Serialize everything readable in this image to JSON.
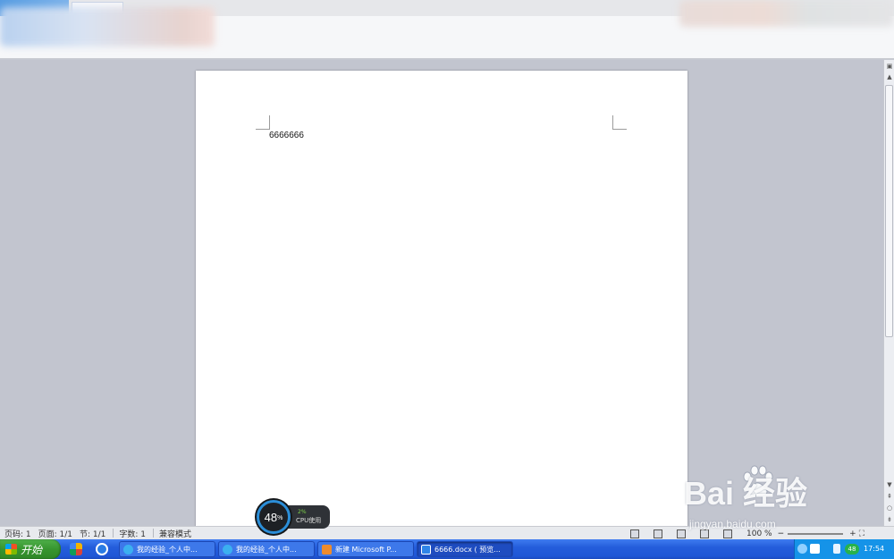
{
  "document": {
    "body_text": "6666666"
  },
  "status_bar": {
    "page_number": "页码: 1",
    "page_count": "页面: 1/1",
    "section": "节: 1/1",
    "word_count": "字数: 1",
    "mode": "兼容模式",
    "zoom": "100 %"
  },
  "cpu_widget": {
    "percent": "48",
    "percent_unit": "%",
    "cpu_small": "2%",
    "cpu_label": "CPU使用"
  },
  "taskbar": {
    "start_label": "开始",
    "tasks": [
      {
        "label": "我的经验_个人中..."
      },
      {
        "label": "我的经验_个人中..."
      },
      {
        "label": "新建 Microsoft P..."
      },
      {
        "label": "6666.docx ( 预览..."
      }
    ],
    "tray_badge": "48",
    "clock": "17:54"
  },
  "watermark": {
    "logo": "Bai  经验",
    "url": "jingyan.baidu.com"
  },
  "colors": {
    "taskbar_blue": "#245ddb",
    "start_green": "#37952f",
    "cpu_ring": "#2b8ed8"
  }
}
